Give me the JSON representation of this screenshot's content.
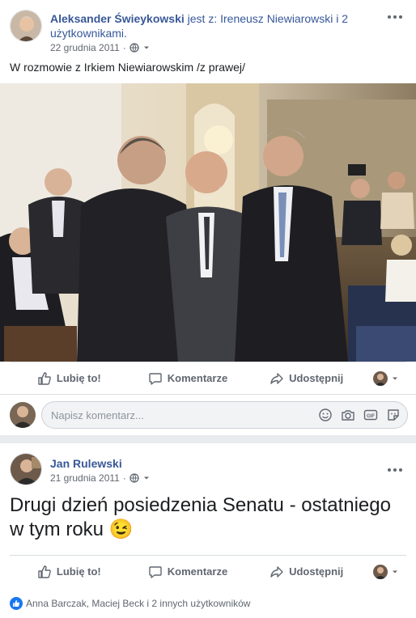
{
  "post1": {
    "author": "Aleksander Świeykowski",
    "with_text": " jest z: Ireneusz Niewiarowski i 2 użytkownikami.",
    "date": "22 grudnia 2011",
    "privacy_icon": "globe-icon",
    "text": "W rozmowie z Irkiem Niewiarowskim /z prawej/",
    "actions": {
      "like": "Lubię to!",
      "comment": "Komentarze",
      "share": "Udostępnij"
    },
    "comment_placeholder": "Napisz komentarz...",
    "comment_icons": [
      "emoji-icon",
      "camera-icon",
      "gif-icon",
      "sticker-icon"
    ]
  },
  "post2": {
    "author": "Jan Rulewski",
    "date": "21 grudnia 2011",
    "privacy_icon": "globe-icon",
    "text": "Drugi dzień posiedzenia Senatu - ostatniego w tym roku",
    "emoji": "😉",
    "actions": {
      "like": "Lubię to!",
      "comment": "Komentarze",
      "share": "Udostępnij"
    },
    "reactions_text": "Anna Barczak, Maciej Beck i 2 innych użytkowników"
  },
  "colors": {
    "link": "#385898",
    "secondary": "#606770",
    "accent": "#1877f2",
    "background": "#e9ebee"
  }
}
